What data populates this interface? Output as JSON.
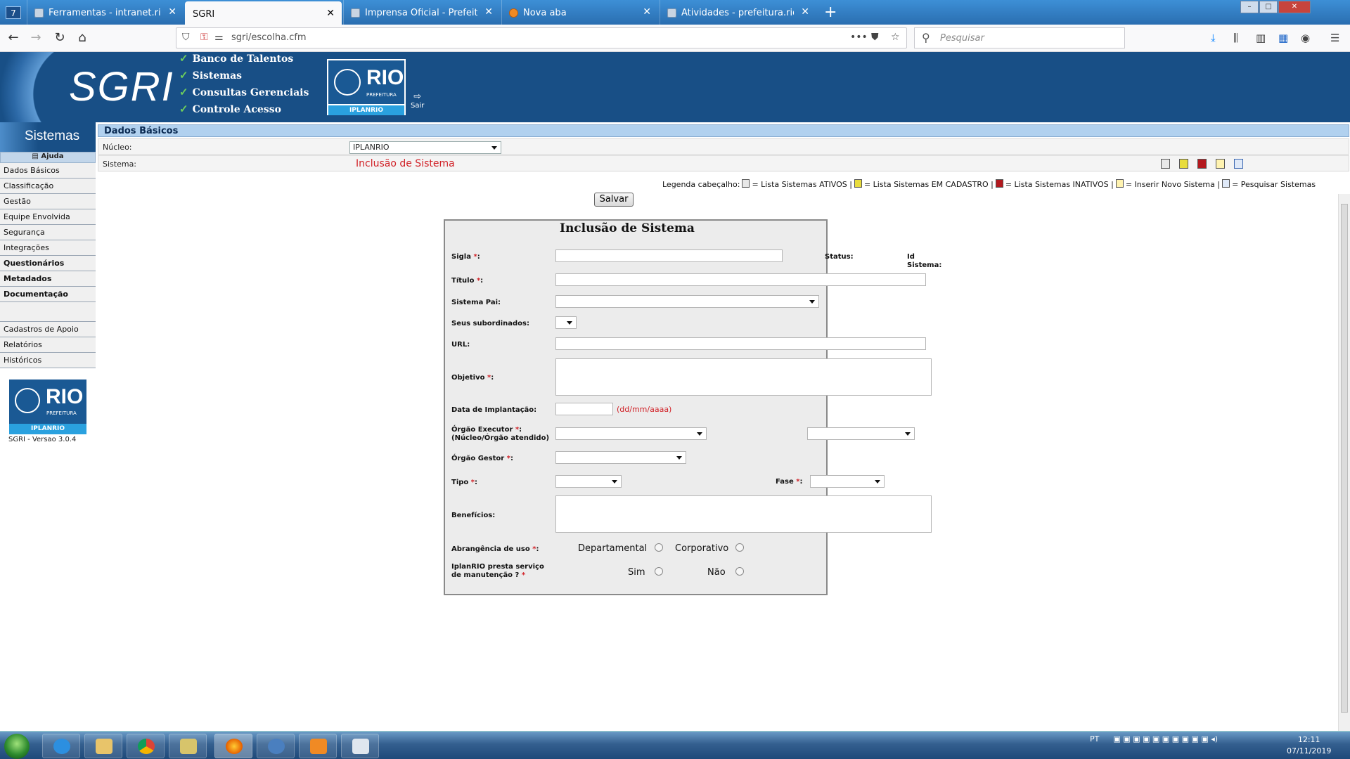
{
  "browser": {
    "window_number": "7",
    "tabs": [
      {
        "label": "Ferramentas - intranet.rio.rj.gov.br",
        "active": false
      },
      {
        "label": "SGRI",
        "active": true
      },
      {
        "label": "Imprensa Oficial - Prefeitura do Rio",
        "active": false
      },
      {
        "label": "Nova aba",
        "active": false
      },
      {
        "label": "Atividades - prefeitura.rio",
        "active": false
      }
    ],
    "url": "sgri/escolha.cfm",
    "search_placeholder": "Pesquisar",
    "new_tab": "+"
  },
  "header": {
    "app_title": "SGRI",
    "menu": [
      "Banco de Talentos",
      "Sistemas",
      "Consultas Gerenciais",
      "Controle Acesso"
    ],
    "logo_text": "RIO",
    "logo_sub": "PREFEITURA",
    "logo_bar": "IPLANRIO",
    "exit_label": "Sair"
  },
  "sidebar": {
    "title": "Sistemas",
    "help": "Ajuda",
    "items": [
      {
        "label": "Dados Básicos",
        "bold": false
      },
      {
        "label": "Classificação",
        "bold": false
      },
      {
        "label": "Gestão",
        "bold": false
      },
      {
        "label": "Equipe Envolvida",
        "bold": false
      },
      {
        "label": "Segurança",
        "bold": false
      },
      {
        "label": "Integrações",
        "bold": false
      },
      {
        "label": "Questionários",
        "bold": true
      },
      {
        "label": "Metadados",
        "bold": true
      },
      {
        "label": "Documentação",
        "bold": true
      }
    ],
    "extra": [
      "Cadastros de Apoio",
      "Relatórios",
      "Históricos"
    ],
    "logo_text": "RIO",
    "logo_sub": "PREFEITURA",
    "logo_bar": "IPLANRIO",
    "version": "SGRI - Versao 3.0.4"
  },
  "main": {
    "section_title": "Dados Básicos",
    "nucleo_label": "Núcleo:",
    "nucleo_value": "IPLANRIO",
    "sistema_label": "Sistema:",
    "sistema_value": "Inclusão de Sistema",
    "legend_prefix": "Legenda cabeçalho:",
    "legend_items": [
      "= Lista Sistemas ATIVOS |",
      "= Lista Sistemas EM CADASTRO |",
      "= Lista Sistemas INATIVOS |",
      "= Inserir Novo Sistema |",
      "= Pesquisar Sistemas"
    ],
    "save_label": "Salvar"
  },
  "form": {
    "title": "Inclusão de Sistema",
    "sigla": "Sigla",
    "status": "Status:",
    "id_sistema": "Id Sistema:",
    "titulo": "Título",
    "sistema_pai": "Sistema Pai:",
    "subordinados": "Seus subordinados:",
    "url": "URL:",
    "objetivo": "Objetivo",
    "data_implantacao": "Data de Implantação:",
    "date_hint": "(dd/mm/aaaa)",
    "orgao_executor_1": "Órgão Executor",
    "orgao_executor_2": "(Núcleo/Órgão atendido)",
    "orgao_gestor": "Órgão Gestor",
    "tipo": "Tipo",
    "fase": "Fase",
    "beneficios": "Benefícios:",
    "abrangencia": "Abrangência de uso",
    "departamental": "Departamental",
    "corporativo": "Corporativo",
    "iplan_1": "IplanRIO presta serviço",
    "iplan_2": "de manutenção ?",
    "sim": "Sim",
    "nao": "Não",
    "required_mark": "*",
    "colon": ":"
  },
  "taskbar": {
    "lang": "PT",
    "time": "12:11",
    "date": "07/11/2019"
  }
}
